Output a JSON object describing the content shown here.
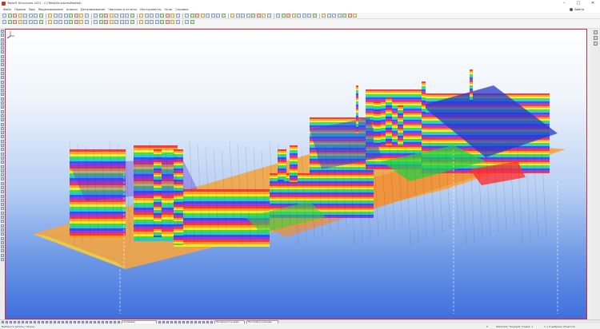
{
  "window": {
    "title": "Tekla® Structures 2021 - C:\\TeklaStructuresModels\\",
    "controls": [
      "–",
      "□",
      "✕"
    ]
  },
  "menu": {
    "items": [
      "Файл",
      "Правка",
      "Вид",
      "Моделирование",
      "Анализ",
      "Деталирование",
      "Чертежи и отчеты",
      "Инструменты",
      "Окно",
      "Справка"
    ],
    "user_name": "Войти"
  },
  "bottom_bar": {
    "view_field": "Активный",
    "field_2": "Прозрачность вида",
    "field_3": "Настройка команды"
  },
  "status": {
    "left": "Выберите деталь / сборку",
    "mid_1": "0",
    "mid_2": "Фамилия: Текущий стадия: 1",
    "right": "1 + 0 выбрано объектов"
  },
  "colors": {
    "viewport_border": "#d8283c",
    "sky_top": "#ffffff",
    "sky_bottom": "#3f6fdc"
  }
}
